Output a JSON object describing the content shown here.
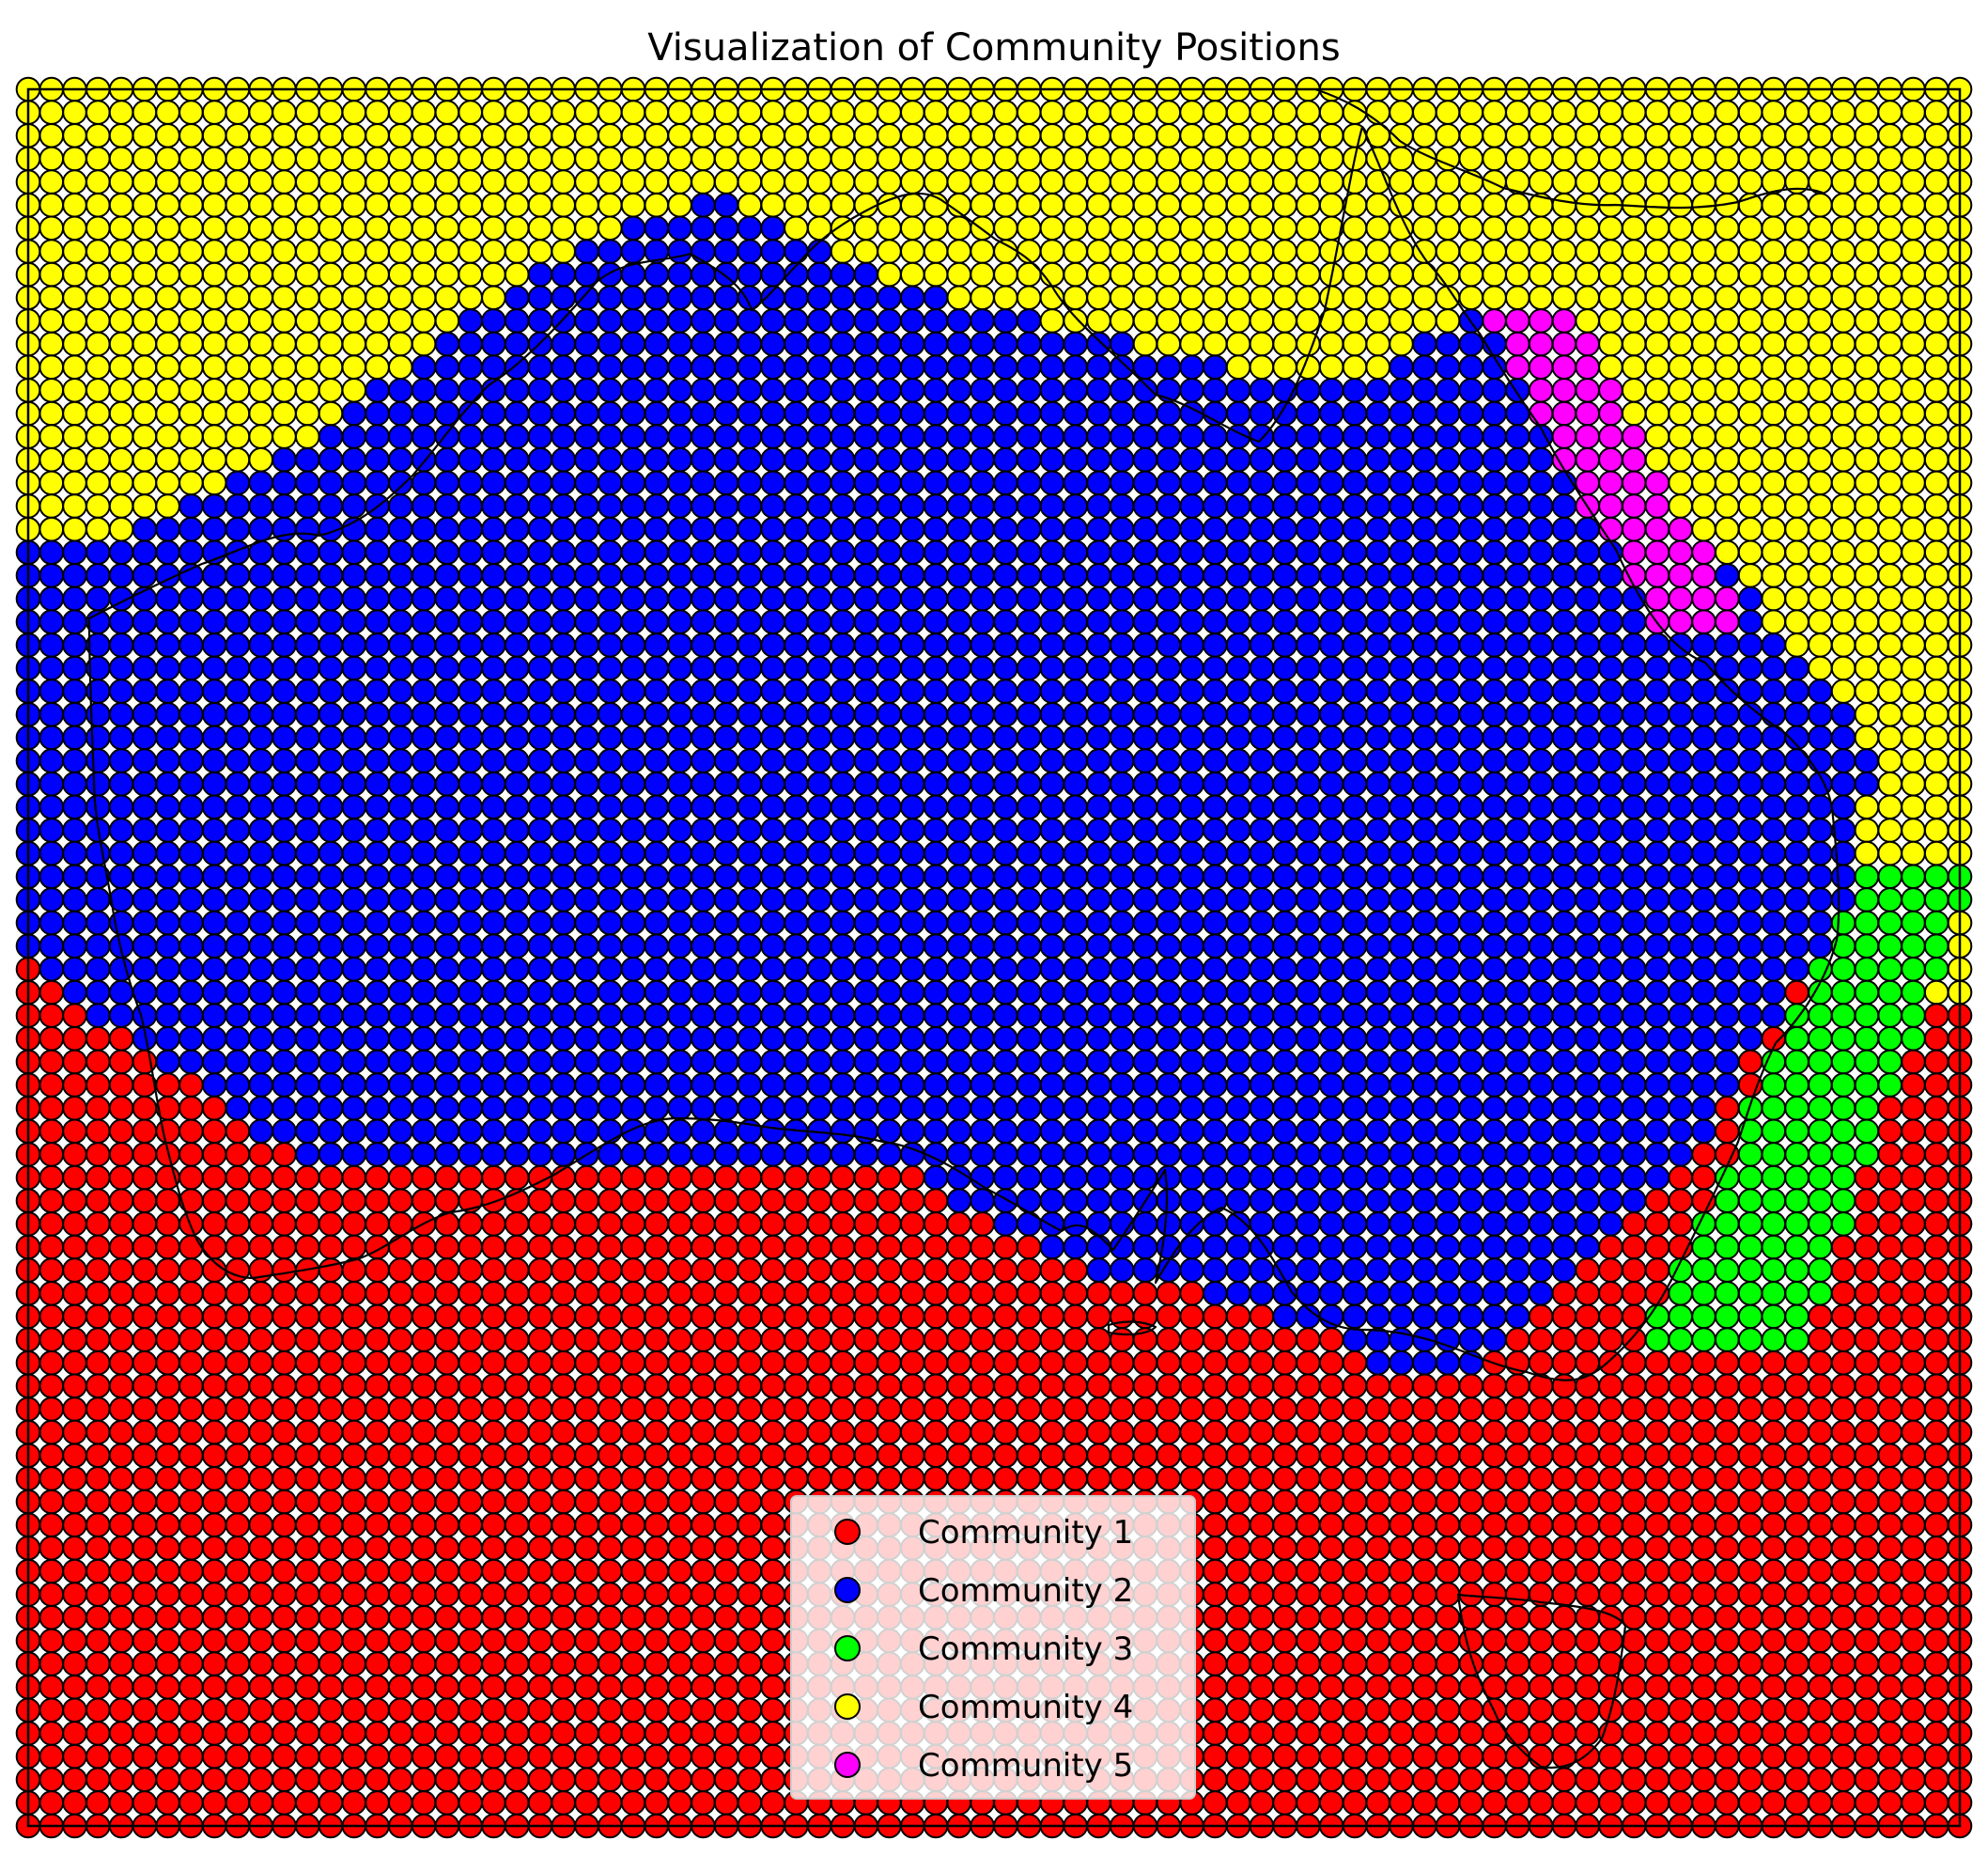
{
  "chart_data": {
    "type": "scatter",
    "title": "Visualization of Community Positions",
    "xlabel": "",
    "ylabel": "",
    "grid": false,
    "axes_ticks": false,
    "basemap": "coastline outline of Australia and Tasmania",
    "marker": "circle",
    "marker_edge_color": "#000000",
    "grid_columns": 84,
    "grid_rows": 76,
    "legend_position": "bottom-center",
    "series": [
      {
        "name": "Community 1",
        "color": "#ff0000",
        "region": "southern band, lower rows"
      },
      {
        "name": "Community 2",
        "color": "#0000ff",
        "region": "continental interior"
      },
      {
        "name": "Community 3",
        "color": "#00ff00",
        "region": "south-east coast strip"
      },
      {
        "name": "Community 4",
        "color": "#ffff00",
        "region": "northern band"
      },
      {
        "name": "Community 5",
        "color": "#ff00ff",
        "region": "north-east coast strip"
      }
    ]
  }
}
